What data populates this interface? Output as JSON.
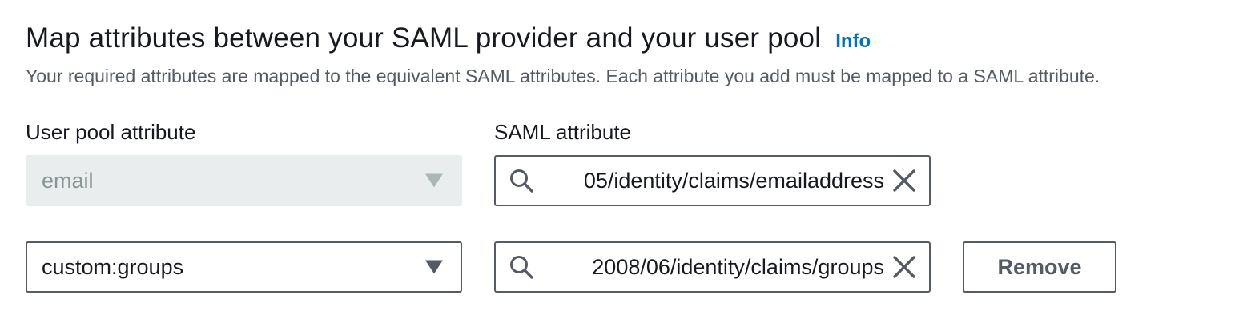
{
  "header": {
    "title": "Map attributes between your SAML provider and your user pool",
    "info_link": "Info",
    "description": "Your required attributes are mapped to the equivalent SAML attributes. Each attribute you add must be mapped to a SAML attribute."
  },
  "columns": {
    "user_pool_label": "User pool attribute",
    "saml_label": "SAML attribute"
  },
  "rows": [
    {
      "user_pool_attribute": "email",
      "user_pool_disabled": true,
      "saml_attribute": "05/identity/claims/emailaddress",
      "removable": false
    },
    {
      "user_pool_attribute": "custom:groups",
      "user_pool_disabled": false,
      "saml_attribute": "2008/06/identity/claims/groups",
      "removable": true,
      "remove_label": "Remove"
    }
  ],
  "colors": {
    "link": "#0073bb",
    "text": "#16191f",
    "secondary_text": "#545b64",
    "disabled_bg": "#eaeded",
    "disabled_text": "#879596",
    "border": "#545b64"
  },
  "icons": {
    "search": "search-icon",
    "clear": "close-icon",
    "dropdown": "caret-down-icon"
  }
}
